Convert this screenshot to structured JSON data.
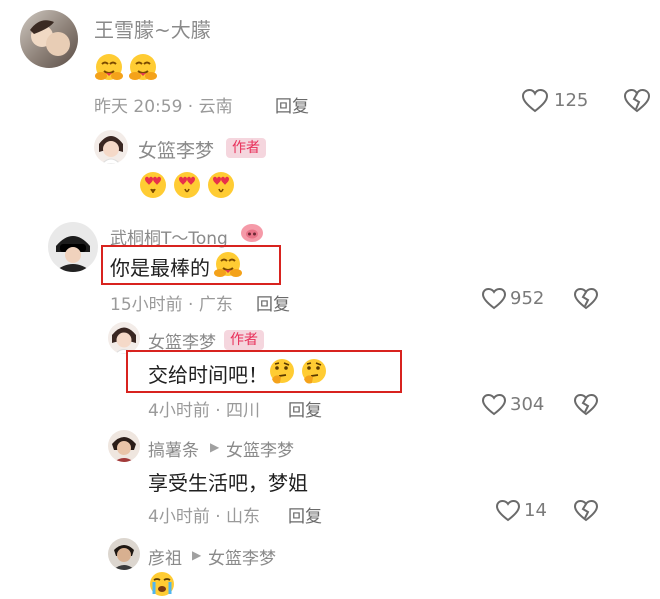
{
  "colors": {
    "accent": "#e8305a",
    "highlight_border": "#d8231f",
    "meta": "#9a9a9a"
  },
  "comments": [
    {
      "user": "王雪朦~大朦",
      "emoji": "hug-emoji x2",
      "time_location": "昨天 20:59 · 云南",
      "reply_label": "回复",
      "likes": "125",
      "replies": [
        {
          "user": "女篮李梦",
          "badge": "作者",
          "emoji": "heart-eyes-emoji x3"
        }
      ]
    },
    {
      "user": "武桐桐T～Tong",
      "text": "你是最棒的",
      "time_location": "15小时前 · 广东",
      "reply_label": "回复",
      "likes": "952",
      "replies": [
        {
          "user": "女篮李梦",
          "badge": "作者",
          "text": "交给时间吧！",
          "time_location": "4小时前 · 四川",
          "reply_label": "回复",
          "likes": "304"
        },
        {
          "user": "搞薯条",
          "reply_to": "女篮李梦",
          "text": "享受生活吧，梦姐",
          "time_location": "4小时前 · 山东",
          "reply_label": "回复",
          "likes": "14"
        },
        {
          "user": "彦祖",
          "reply_to": "女篮李梦",
          "emoji": "crying-emoji"
        }
      ]
    }
  ]
}
